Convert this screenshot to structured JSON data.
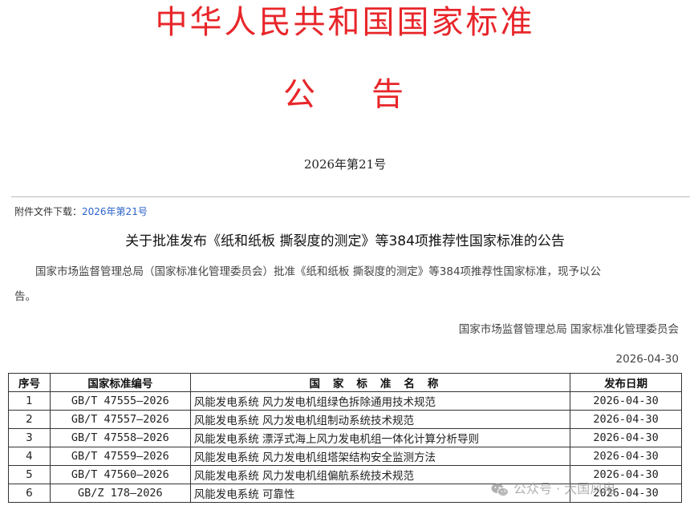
{
  "header": {
    "title": "中华人民共和国国家标准",
    "notice": "公告",
    "issue_no": "2026年第21号"
  },
  "attachment": {
    "label": "附件文件下载：",
    "link": "2026年第21号"
  },
  "announcement": {
    "headline": "关于批准发布《纸和纸板 撕裂度的测定》等384项推荐性国家标准的公告",
    "paragraph_line1": "国家市场监督管理总局（国家标准化管理委员会）批准《纸和纸板 撕裂度的测定》等384项推荐性国家标准，现予以公",
    "paragraph_line2": "告。",
    "signature": "国家市场监督管理总局 国家标准化管理委员会",
    "date": "2026-04-30"
  },
  "table": {
    "headers": [
      "序号",
      "国家标准编号",
      "国家标准名称",
      "发布日期"
    ],
    "rows": [
      {
        "no": "1",
        "code": "GB/T 47555—2026",
        "name": "风能发电系统 风力发电机组绿色拆除通用技术规范",
        "date": "2026-04-30"
      },
      {
        "no": "2",
        "code": "GB/T 47557—2026",
        "name": "风能发电系统 风力发电机组制动系统技术规范",
        "date": "2026-04-30"
      },
      {
        "no": "3",
        "code": "GB/T 47558—2026",
        "name": "风能发电系统 漂浮式海上风力发电机组一体化计算分析导则",
        "date": "2026-04-30"
      },
      {
        "no": "4",
        "code": "GB/T 47559—2026",
        "name": "风能发电系统 风力发电机组塔架结构安全监测方法",
        "date": "2026-04-30"
      },
      {
        "no": "5",
        "code": "GB/T 47560—2026",
        "name": "风能发电系统 风力发电机组偏航系统技术规范",
        "date": "2026-04-30"
      },
      {
        "no": "6",
        "code": "GB/Z 178—2026",
        "name": "风能发电系统 可靠性",
        "date": "2026-04-30"
      }
    ]
  },
  "watermark": {
    "icon": "wechat-icon",
    "text": "公众号 · 大国风电"
  }
}
